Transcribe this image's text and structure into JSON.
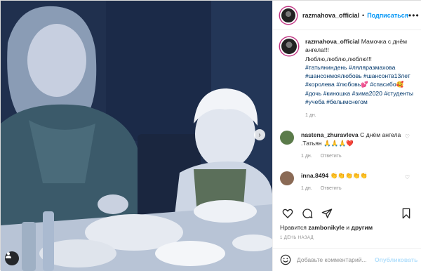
{
  "post": {
    "username": "razmahova_official",
    "follow_label": "Подписаться",
    "dot": "•",
    "more_label": "•••"
  },
  "caption": {
    "username": "razmahova_official",
    "text": "Мамочка с днём ангела!!!",
    "line2": "Люблю,люблю,люблю!!!",
    "hashtags": "#татьяниндень #ляляразмахова #шансонмоялюбовь #шансонтв13лет #королева #любовь💕 #спасибо🥰 #дочь #киношка #зима2020 #студенты #учеба #белымснегом",
    "time": "1 дн."
  },
  "comments": [
    {
      "username": "nastena_zhuravleva",
      "text": "С днём ангела .Татьян 🙏🙏🙏❤️",
      "time": "1 дн.",
      "reply": "Ответить",
      "avatar_color": "#5b7b4a"
    },
    {
      "username": "inna.8494",
      "text": "👏👏👏👏👏",
      "time": "1 дн.",
      "reply": "Ответить",
      "avatar_color": "#8a6a55"
    }
  ],
  "likes": {
    "prefix": "Нравится",
    "user": "zambonikyle",
    "middle": "и",
    "others": "другим"
  },
  "date": "1 день назад",
  "add_comment": {
    "placeholder": "Добавьте комментарий...",
    "publish_label": "Опубликовать"
  },
  "icons": {
    "like": "heart-icon",
    "comment": "comment-icon",
    "share": "share-icon",
    "save": "bookmark-icon",
    "next": "chevron-right-icon",
    "emoji": "smile-icon",
    "more": "more-icon",
    "user_tag": "user-icon"
  },
  "colors": {
    "accent": "#0095f6",
    "muted": "#8e8e8e",
    "publish_disabled": "#b2dffc"
  }
}
